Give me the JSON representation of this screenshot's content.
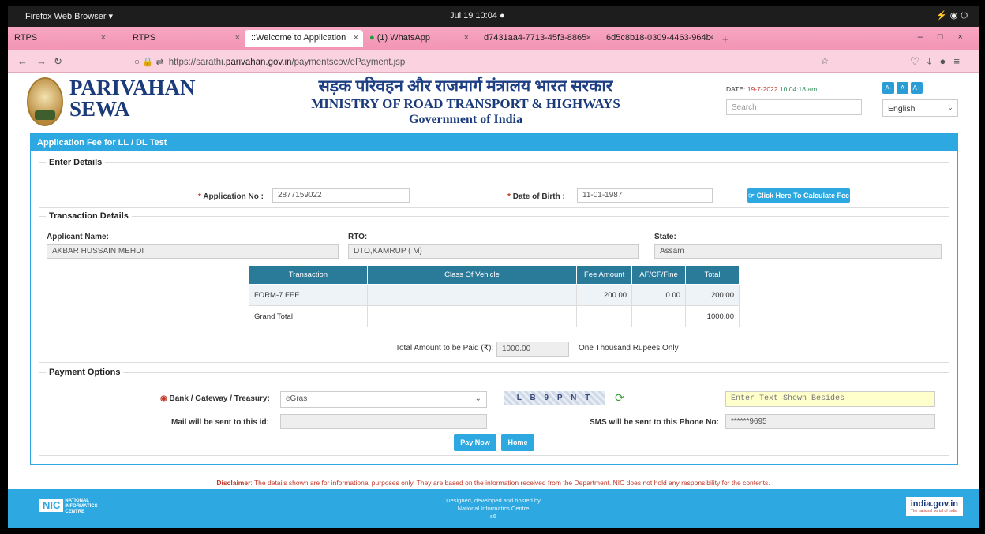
{
  "os": {
    "app_menu": "Firefox Web Browser ▾",
    "clock": "Jul 19  10:04  ●"
  },
  "browser": {
    "tabs": [
      {
        "label": "RTPS"
      },
      {
        "label": "RTPS"
      },
      {
        "label": "::Welcome to Application"
      },
      {
        "label": "(1) WhatsApp"
      },
      {
        "label": "d7431aa4-7713-45f3-8865-"
      },
      {
        "label": "6d5c8b18-0309-4463-964b-"
      }
    ],
    "url_prefix": "https://sarathi.",
    "url_domain": "parivahan.gov.in",
    "url_path": "/paymentscov/ePayment.jsp"
  },
  "header": {
    "brand_line1": "PARIVAHAN",
    "brand_line2": "SEWA",
    "ministry_hindi": "सड़क परिवहन और राजमार्ग मंत्रालय भारत सरकार",
    "ministry_en": "MINISTRY OF ROAD TRANSPORT & HIGHWAYS",
    "government": "Government of India",
    "date_label": "DATE:",
    "date_value": "19-7-2022",
    "time_value": "10:04:18 am",
    "search_placeholder": "Search",
    "font_buttons": [
      "A-",
      "A",
      "A+"
    ],
    "language": "English"
  },
  "panel": {
    "title": "Application Fee for LL / DL Test",
    "enter_details": {
      "legend": "Enter Details",
      "app_no_label": "Application No :",
      "app_no_value": "2877159022",
      "dob_label": "Date of Birth :",
      "dob_value": "11-01-1987",
      "calc_button": "Click Here To Calculate Fee"
    },
    "transaction": {
      "legend": "Transaction Details",
      "applicant_label": "Applicant Name:",
      "applicant_value": "AKBAR HUSSAIN MEHDI",
      "rto_label": "RTO:",
      "rto_value": "DTO,KAMRUP ( M)",
      "state_label": "State:",
      "state_value": "Assam",
      "headers": [
        "Transaction",
        "Class Of Vehicle",
        "Fee Amount",
        "AF/CF/Fine",
        "Total"
      ],
      "rows": [
        {
          "transaction": "FORM-7 FEE",
          "cov": "",
          "fee": "200.00",
          "af": "0.00",
          "total": "200.00"
        }
      ],
      "grand_total_label": "Grand Total",
      "grand_total_value": "1000.00",
      "amount_label": "Total Amount to be Paid (₹):",
      "amount_value": "1000.00",
      "amount_words": "One Thousand Rupees Only"
    },
    "payment": {
      "legend": "Payment Options",
      "gateway_label": "Bank / Gateway / Treasury:",
      "gateway_value": "eGras",
      "captcha_text": "L B 9 P N T",
      "captcha_placeholder": "Enter Text Shown Besides",
      "mail_label": "Mail will be sent to this id:",
      "sms_label": "SMS will be sent to this Phone No:",
      "sms_value": "******9695",
      "pay_button": "Pay Now",
      "home_button": "Home"
    }
  },
  "disclaimer": {
    "label": "Disclaimer",
    "text": ": The details shown are for informational purposes only. They are based on the information received from the Department. NIC does not hold any responsibility for the contents."
  },
  "footer": {
    "nic_logo": "NIC",
    "nic_text": "NATIONAL INFORMATICS CENTRE",
    "credit_line1": "Designed, developed and hosted by",
    "credit_line2": "National Informatics Centre",
    "credit_line3": "s6",
    "india_gov": "india.gov.in",
    "india_gov_sub": "The national portal of India"
  }
}
